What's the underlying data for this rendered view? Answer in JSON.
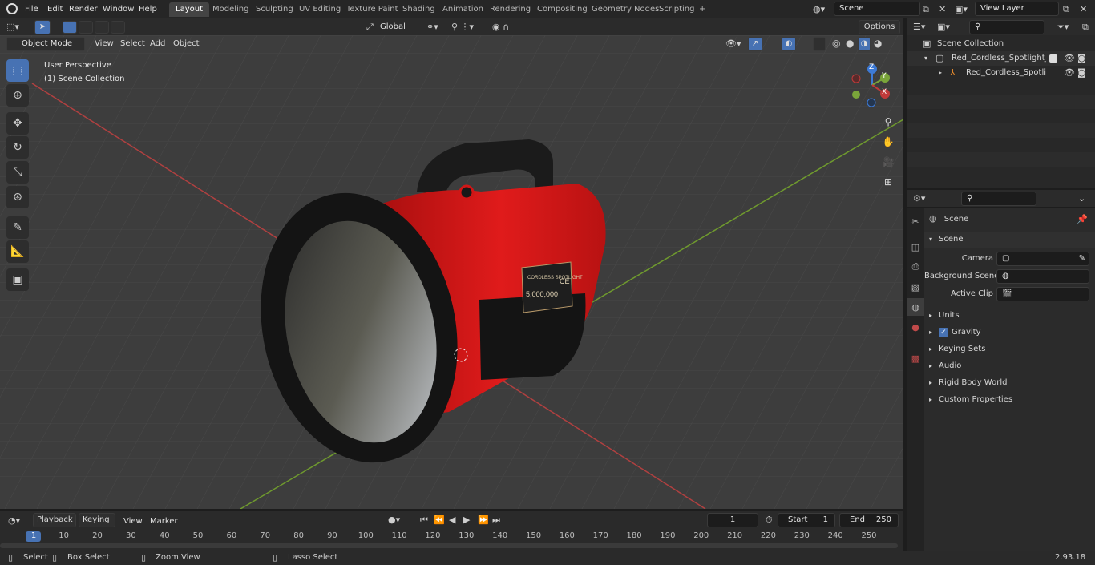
{
  "topmenu": [
    "File",
    "Edit",
    "Render",
    "Window",
    "Help"
  ],
  "workspaces": [
    "Layout",
    "Modeling",
    "Sculpting",
    "UV Editing",
    "Texture Paint",
    "Shading",
    "Animation",
    "Rendering",
    "Compositing",
    "Geometry Nodes",
    "Scripting"
  ],
  "add_tab": "+",
  "scene_field": "Scene",
  "viewlayer_field": "View Layer",
  "viewport_header": {
    "mode": "Object Mode",
    "menus": [
      "View",
      "Select",
      "Add",
      "Object"
    ],
    "transform": "Global",
    "options": "Options"
  },
  "overlay_text": {
    "perspective": "User Perspective",
    "collection": "(1) Scene Collection"
  },
  "label_panel": {
    "line1": "CORDLESS SPOTLIGHT",
    "line2": "5,000,000",
    "mark": "CE"
  },
  "gizmo": {
    "z": "Z",
    "y": "Y",
    "x": "X"
  },
  "outliner": {
    "root": "Scene Collection",
    "items": [
      {
        "label": "Red_Cordless_Spotlight_and_"
      },
      {
        "label": "Red_Cordless_Spotlight_a"
      }
    ]
  },
  "properties": {
    "breadcrumb": "Scene",
    "panel": "Scene",
    "fields": [
      {
        "label": "Camera"
      },
      {
        "label": "Background Scene"
      },
      {
        "label": "Active Clip"
      }
    ],
    "sections": [
      "Units",
      "Gravity",
      "Keying Sets",
      "Audio",
      "Rigid Body World",
      "Custom Properties"
    ],
    "gravity_checked": true
  },
  "timeline": {
    "menus": [
      "Playback",
      "Keying",
      "View",
      "Marker"
    ],
    "current_frame": "1",
    "start_label": "Start",
    "start": "1",
    "end_label": "End",
    "end": "250",
    "ticks": [
      "1",
      "10",
      "20",
      "30",
      "40",
      "50",
      "60",
      "70",
      "80",
      "90",
      "100",
      "110",
      "120",
      "130",
      "140",
      "150",
      "160",
      "170",
      "180",
      "190",
      "200",
      "210",
      "220",
      "230",
      "240",
      "250"
    ]
  },
  "statusbar": {
    "items": [
      "Select",
      "Box Select",
      "Zoom View",
      "Lasso Select"
    ],
    "version": "2.93.18"
  },
  "colors": {
    "accent": "#4772b3",
    "x_axis": "#c03a3a",
    "y_axis": "#7aa53a",
    "z_axis": "#3d7ad6",
    "body_red": "#d81818"
  }
}
